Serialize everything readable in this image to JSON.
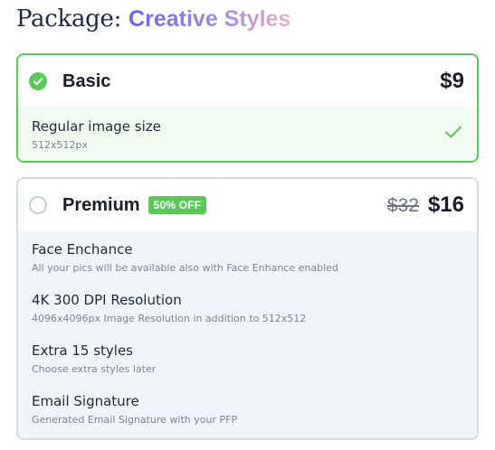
{
  "package": {
    "label": "Package:",
    "name": "Creative Styles"
  },
  "plans": {
    "basic": {
      "title": "Basic",
      "price": "$9",
      "selected": true,
      "features": [
        {
          "title": "Regular image size",
          "subtitle": "512x512px"
        }
      ]
    },
    "premium": {
      "title": "Premium",
      "badge": "50% OFF",
      "old_price": "$32",
      "price": "$16",
      "selected": false,
      "features": [
        {
          "title": "Face Enchance",
          "subtitle": "All your pics will be available also with Face Enhance enabled"
        },
        {
          "title": "4K 300 DPI Resolution",
          "subtitle": "4096x4096px Image Resolution in addition to 512x512"
        },
        {
          "title": "Extra 15 styles",
          "subtitle": "Choose extra styles later"
        },
        {
          "title": "Email Signature",
          "subtitle": "Generated Email Signature with your PFP"
        }
      ]
    }
  },
  "colors": {
    "accent_green": "#5cc85c",
    "gradient_start": "#6d63e6",
    "gradient_end": "#e8b2c4"
  },
  "icons": {
    "selected": "check-circle-icon",
    "unselected": "radio-empty-icon",
    "included": "checkmark-icon"
  }
}
